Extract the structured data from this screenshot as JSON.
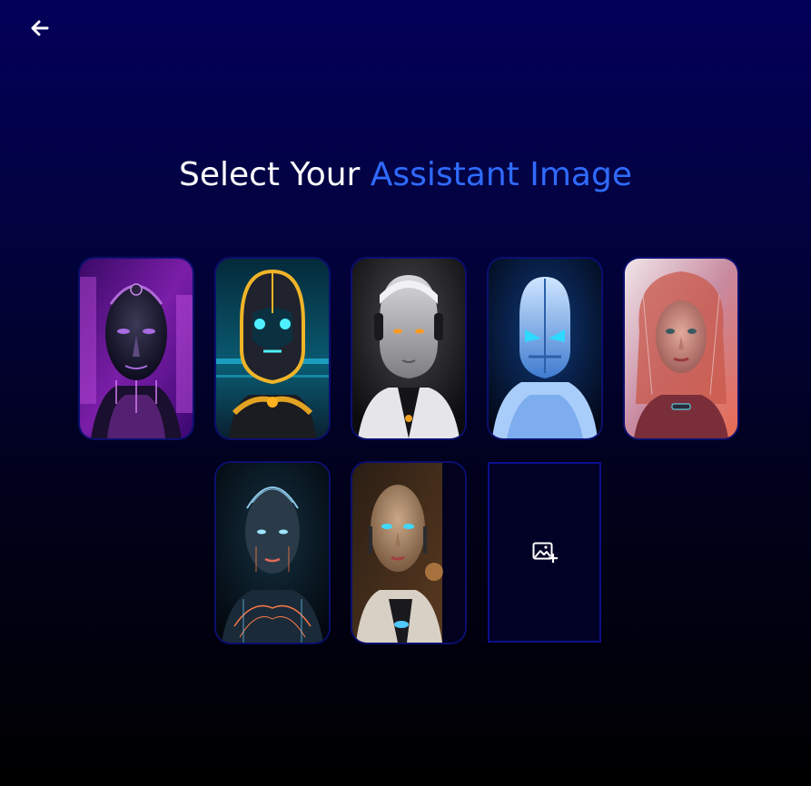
{
  "header": {
    "back_icon": "arrow-left-icon"
  },
  "title": {
    "prefix": "Select Your",
    "accent": "Assistant Image",
    "accent_color": "#2f6bff"
  },
  "assistant_images": [
    {
      "id": "purple-cyborg-male",
      "theme": "purple metallic cyborg"
    },
    {
      "id": "gold-cyan-robot",
      "theme": "gold and cyan robot"
    },
    {
      "id": "white-android-orange-eyes",
      "theme": "white android with orange eyes"
    },
    {
      "id": "blue-armored-robot",
      "theme": "blue glowing armored robot"
    },
    {
      "id": "red-haired-cyber-woman",
      "theme": "red-haired cyber woman"
    },
    {
      "id": "circuit-woman",
      "theme": "dark circuit-patterned woman"
    },
    {
      "id": "bronze-android-blue-eyes",
      "theme": "bronze android with blue eyes"
    }
  ],
  "upload": {
    "icon": "image-plus-icon"
  }
}
